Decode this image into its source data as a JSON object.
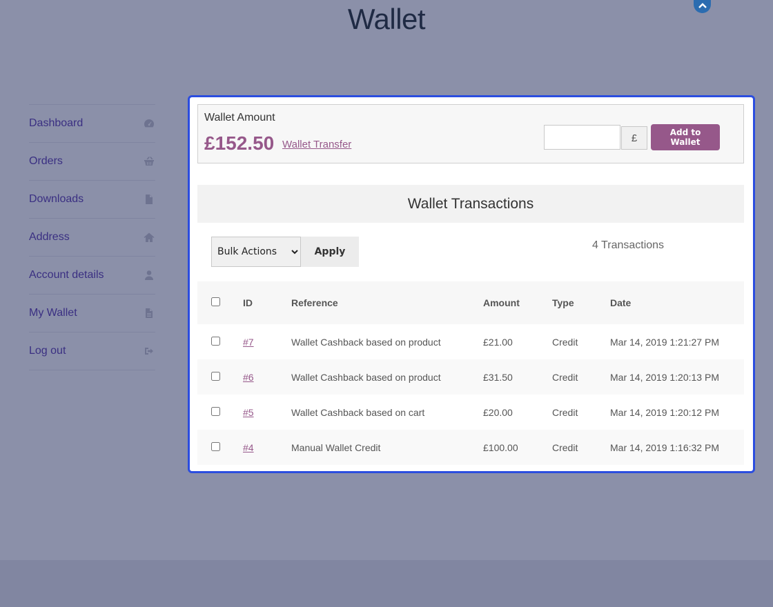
{
  "page": {
    "title": "Wallet"
  },
  "nav": {
    "items": [
      {
        "label": "Dashboard",
        "icon": "dashboard-icon"
      },
      {
        "label": "Orders",
        "icon": "basket-icon"
      },
      {
        "label": "Downloads",
        "icon": "file-icon"
      },
      {
        "label": "Address",
        "icon": "home-icon"
      },
      {
        "label": "Account details",
        "icon": "user-icon"
      },
      {
        "label": "My Wallet",
        "icon": "file-text-icon"
      },
      {
        "label": "Log out",
        "icon": "sign-out-icon"
      }
    ]
  },
  "wallet": {
    "label": "Wallet Amount",
    "amount": "£152.50",
    "transfer_link": "Wallet Transfer",
    "currency_symbol": "£",
    "add_button": "Add to Wallet",
    "input_value": ""
  },
  "transactions": {
    "title": "Wallet Transactions",
    "bulk_select_value": "Bulk Actions",
    "apply_button": "Apply",
    "count_text": "4 Transactions",
    "columns": {
      "id": "ID",
      "reference": "Reference",
      "amount": "Amount",
      "type": "Type",
      "date": "Date"
    },
    "rows": [
      {
        "id": "#7",
        "reference": "Wallet Cashback based on product",
        "amount": "£21.00",
        "type": "Credit",
        "date": "Mar 14, 2019 1:21:27 PM"
      },
      {
        "id": "#6",
        "reference": "Wallet Cashback based on product",
        "amount": "£31.50",
        "type": "Credit",
        "date": "Mar 14, 2019 1:20:13 PM"
      },
      {
        "id": "#5",
        "reference": "Wallet Cashback based on cart",
        "amount": "£20.00",
        "type": "Credit",
        "date": "Mar 14, 2019 1:20:12 PM"
      },
      {
        "id": "#4",
        "reference": "Manual Wallet Credit",
        "amount": "£100.00",
        "type": "Credit",
        "date": "Mar 14, 2019 1:16:32 PM"
      }
    ]
  },
  "colors": {
    "background": "#8b90a9",
    "accent": "#96588a",
    "panel_border": "#2b4de0",
    "nav_text": "#3a2f82"
  }
}
